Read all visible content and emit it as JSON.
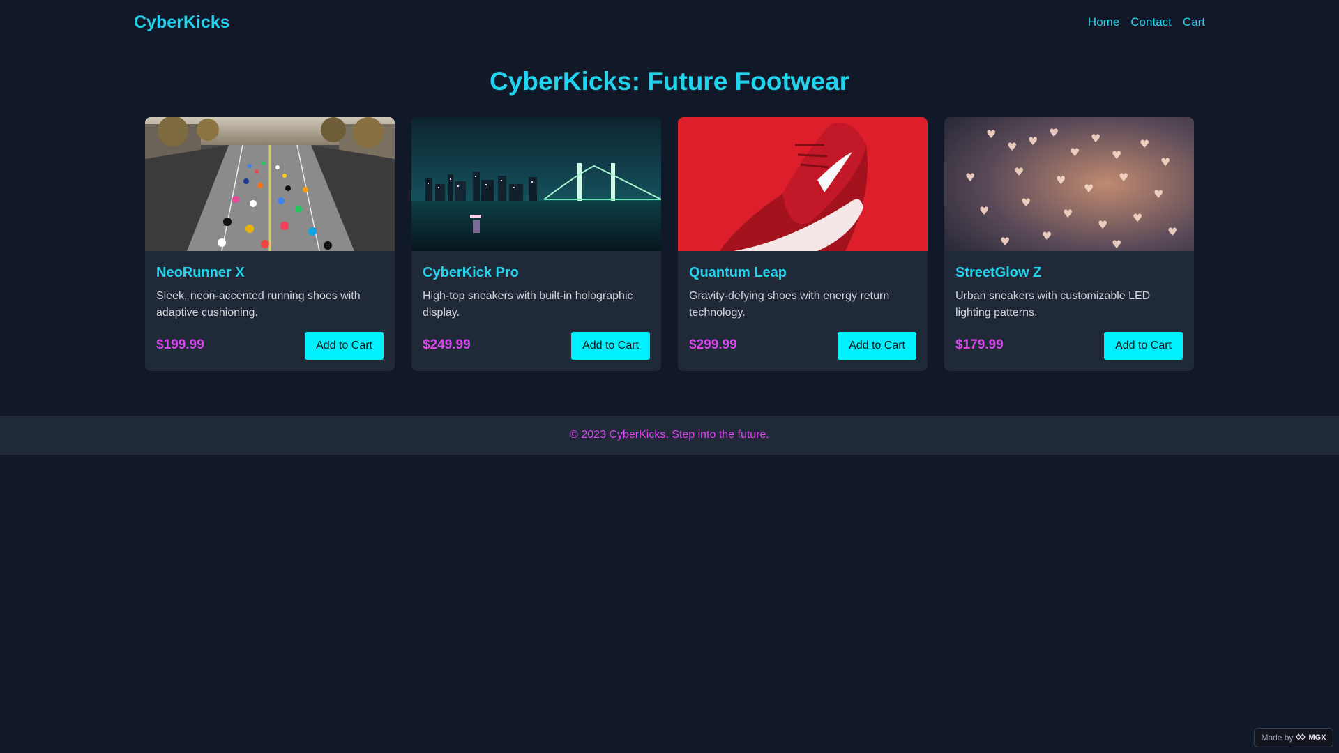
{
  "header": {
    "logo": "CyberKicks",
    "nav": [
      "Home",
      "Contact",
      "Cart"
    ]
  },
  "main": {
    "title": "CyberKicks: Future Footwear",
    "products": [
      {
        "name": "NeoRunner X",
        "description": "Sleek, neon-accented running shoes with adaptive cushioning.",
        "price": "$199.99",
        "button": "Add to Cart",
        "image": "marathon-runners-street-photo"
      },
      {
        "name": "CyberKick Pro",
        "description": "High-top sneakers with built-in holographic display.",
        "price": "$249.99",
        "button": "Add to Cart",
        "image": "night-city-bridge-photo"
      },
      {
        "name": "Quantum Leap",
        "description": "Gravity-defying shoes with energy return technology.",
        "price": "$299.99",
        "button": "Add to Cart",
        "image": "red-sneaker-photo"
      },
      {
        "name": "StreetGlow Z",
        "description": "Urban sneakers with customizable LED lighting patterns.",
        "price": "$179.99",
        "button": "Add to Cart",
        "image": "heart-bokeh-photo"
      }
    ]
  },
  "footer": {
    "text": "© 2023 CyberKicks. Step into the future."
  },
  "badge": {
    "made_by": "Made by",
    "brand": "MGX"
  },
  "colors": {
    "background": "#111827",
    "card": "#1f2937",
    "accent": "#22d3ee",
    "price": "#d946ef",
    "button": "#00f0ff"
  }
}
